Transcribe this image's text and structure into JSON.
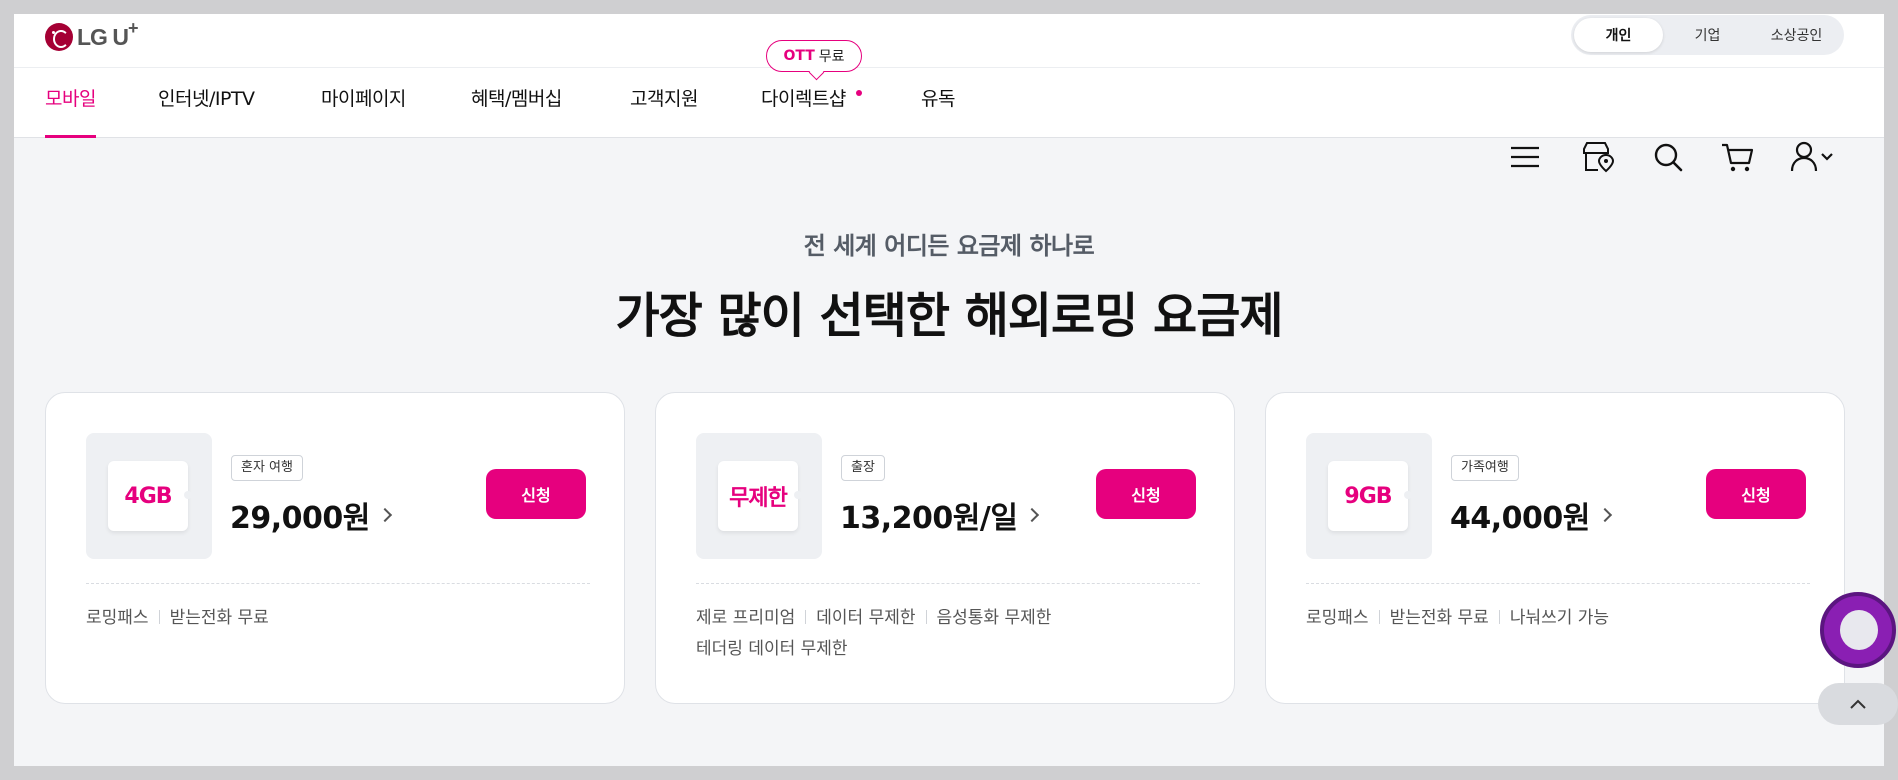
{
  "header": {
    "logo_text": "LG U",
    "logo_plus": "+",
    "segments": [
      "개인",
      "기업",
      "소상공인"
    ],
    "active_segment": "개인"
  },
  "nav": {
    "items": [
      "모바일",
      "인터넷/IPTV",
      "마이페이지",
      "혜택/멤버십",
      "고객지원",
      "다이렉트샵",
      "유독"
    ],
    "active": "모바일",
    "badge_ott": "OTT",
    "badge_free": "무료",
    "icons": [
      "menu-icon",
      "store-icon",
      "search-icon",
      "cart-icon",
      "user-icon"
    ]
  },
  "section": {
    "subtitle": "전 세계 어디든 요금제 하나로",
    "title": "가장 많이 선택한 해외로밍 요금제"
  },
  "cards": [
    {
      "thumb": "4GB",
      "tag": "혼자 여행",
      "price": "29,000원",
      "button": "신청",
      "features": [
        "로밍패스",
        "받는전화 무료"
      ]
    },
    {
      "thumb": "무제한",
      "tag": "출장",
      "price": "13,200원/일",
      "button": "신청",
      "features": [
        "제로 프리미엄",
        "데이터 무제한",
        "음성통화 무제한",
        "테더링 데이터 무제한"
      ]
    },
    {
      "thumb": "9GB",
      "tag": "가족여행",
      "price": "44,000원",
      "button": "신청",
      "features": [
        "로밍패스",
        "받는전화 무료",
        "나눠쓰기 가능"
      ]
    }
  ],
  "colors": {
    "accent": "#e6007e",
    "brand": "#a50034",
    "background": "#f4f5f7"
  }
}
